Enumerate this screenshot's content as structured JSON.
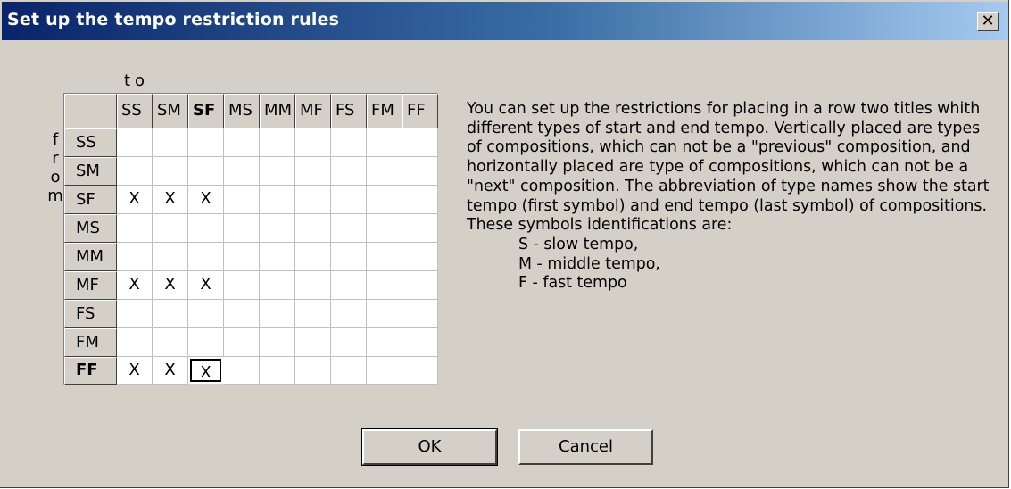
{
  "window": {
    "title": "Set up the tempo restriction rules",
    "close_glyph": "✕"
  },
  "grid": {
    "to_label": "to",
    "from_letters": [
      "f",
      "r",
      "o",
      "m"
    ],
    "columns": [
      "SS",
      "SM",
      "SF",
      "MS",
      "MM",
      "MF",
      "FS",
      "FM",
      "FF"
    ],
    "rows": [
      "SS",
      "SM",
      "SF",
      "MS",
      "MM",
      "MF",
      "FS",
      "FM",
      "FF"
    ],
    "cells": [
      [
        "",
        "",
        "",
        "",
        "",
        "",
        "",
        "",
        ""
      ],
      [
        "",
        "",
        "",
        "",
        "",
        "",
        "",
        "",
        ""
      ],
      [
        "X",
        "X",
        "X",
        "",
        "",
        "",
        "",
        "",
        ""
      ],
      [
        "",
        "",
        "",
        "",
        "",
        "",
        "",
        "",
        ""
      ],
      [
        "",
        "",
        "",
        "",
        "",
        "",
        "",
        "",
        ""
      ],
      [
        "X",
        "X",
        "X",
        "",
        "",
        "",
        "",
        "",
        ""
      ],
      [
        "",
        "",
        "",
        "",
        "",
        "",
        "",
        "",
        ""
      ],
      [
        "",
        "",
        "",
        "",
        "",
        "",
        "",
        "",
        ""
      ],
      [
        "X",
        "X",
        "X",
        "",
        "",
        "",
        "",
        "",
        ""
      ]
    ],
    "selected_column": "SF",
    "selected_row": "FF",
    "focused_cell": {
      "row": 8,
      "col": 2
    }
  },
  "description": {
    "text": "You can set up the restrictions for placing in a row two titles whith different types of start and end tempo. Vertically placed are types of compositions, which can not be a \"previous\" composition, and horizontally placed are type of compositions, which can not be a \"next\" composition. The abbreviation of type names show the start tempo (first symbol) and end tempo (last symbol) of compositions. These symbols identifications are:",
    "items": [
      "S - slow tempo,",
      "M - middle tempo,",
      "F - fast tempo"
    ]
  },
  "buttons": {
    "ok": "OK",
    "cancel": "Cancel"
  }
}
